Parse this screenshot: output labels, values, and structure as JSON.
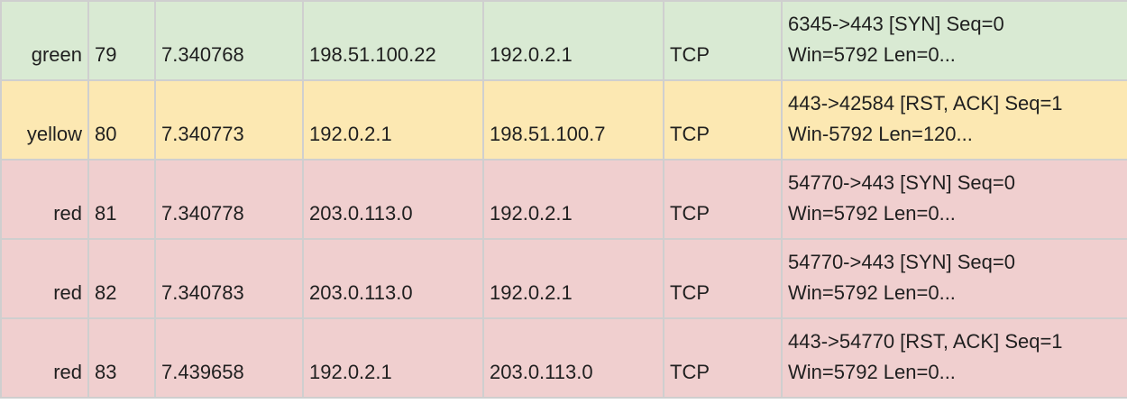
{
  "rows": [
    {
      "color": "green",
      "no": "79",
      "time": "7.340768",
      "source": "198.51.100.22",
      "destination": "192.0.2.1",
      "protocol": "TCP",
      "info_line1": "6345->443 [SYN] Seq=0",
      "info_line2": "Win=5792 Len=0..."
    },
    {
      "color": "yellow",
      "no": "80",
      "time": "7.340773",
      "source": "192.0.2.1",
      "destination": "198.51.100.7",
      "protocol": "TCP",
      "info_line1": "443->42584 [RST, ACK] Seq=1",
      "info_line2": "Win-5792 Len=120..."
    },
    {
      "color": "red",
      "no": "81",
      "time": "7.340778",
      "source": "203.0.113.0",
      "destination": "192.0.2.1",
      "protocol": "TCP",
      "info_line1": "54770->443 [SYN] Seq=0",
      "info_line2": "Win=5792 Len=0..."
    },
    {
      "color": "red",
      "no": "82",
      "time": "7.340783",
      "source": "203.0.113.0",
      "destination": "192.0.2.1",
      "protocol": "TCP",
      "info_line1": "54770->443 [SYN] Seq=0",
      "info_line2": "Win=5792 Len=0..."
    },
    {
      "color": "red",
      "no": "83",
      "time": "7.439658",
      "source": "192.0.2.1",
      "destination": "203.0.113.0",
      "protocol": "TCP",
      "info_line1": "443->54770 [RST, ACK] Seq=1",
      "info_line2": "Win=5792 Len=0..."
    }
  ],
  "colors": {
    "green": "#d9ead3",
    "yellow": "#fce8b2",
    "red": "#f0cfcf",
    "border": "#cfcfcf"
  }
}
